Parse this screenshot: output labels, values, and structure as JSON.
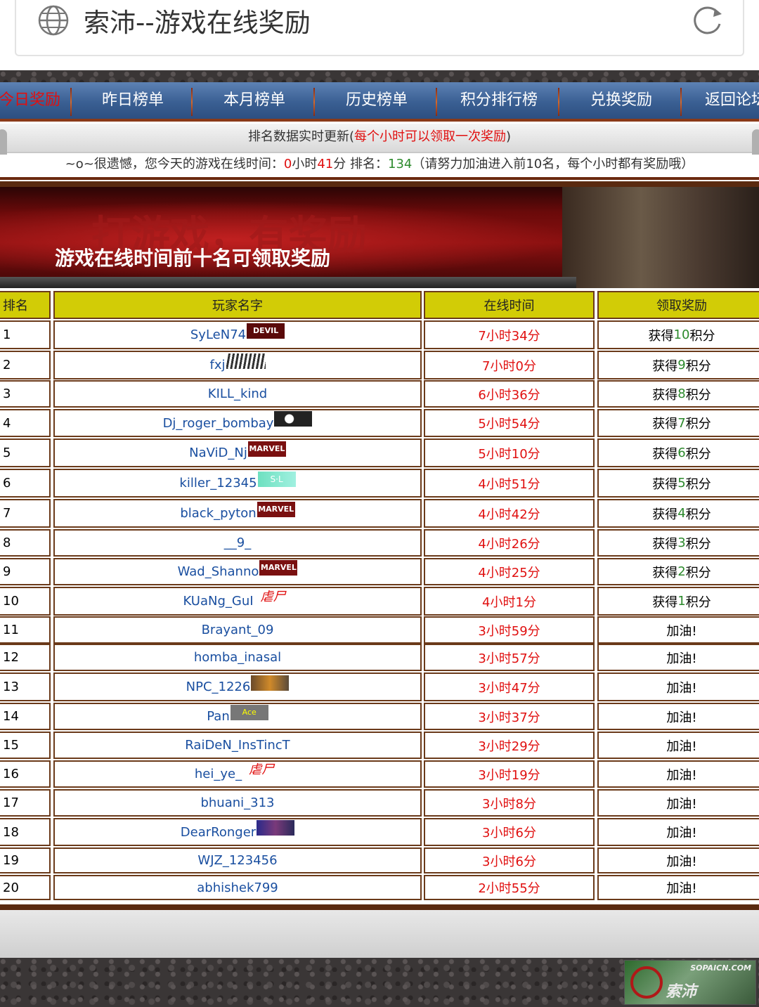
{
  "browser": {
    "title": "索沛--游戏在线奖励"
  },
  "nav": {
    "items": [
      {
        "label": "今日奖励",
        "active": true
      },
      {
        "label": "昨日榜单",
        "active": false
      },
      {
        "label": "本月榜单",
        "active": false
      },
      {
        "label": "历史榜单",
        "active": false
      },
      {
        "label": "积分排行榜",
        "active": false
      },
      {
        "label": "兑换奖励",
        "active": false
      },
      {
        "label": "返回论坛",
        "active": false
      }
    ]
  },
  "notice": {
    "line1_prefix": "排名数据实时更新(",
    "line1_highlight": "每个小时可以领取一次奖励",
    "line1_suffix": ")",
    "line2_a": "~o~很遗憾，您今天的游戏在线时间：",
    "hours": "0",
    "line2_b": "小时",
    "minutes": "41",
    "line2_c": "分 排名：",
    "rank": "134",
    "line2_d": "（请努力加油进入前10名，每个小时都有奖励哦）"
  },
  "banner": {
    "bg_text": "打游戏，有奖励",
    "caption": "游戏在线时间前十名可领取奖励"
  },
  "table": {
    "headers": [
      "排名",
      "玩家名字",
      "在线时间",
      "领取奖励"
    ],
    "rows": [
      {
        "rank": "1",
        "name": "SyLeN74",
        "badge": "devil",
        "time": "7小时34分",
        "reward_a": "获得",
        "points": "10",
        "reward_b": "积分"
      },
      {
        "rank": "2",
        "name": "fxj",
        "badge": "rays",
        "time": "7小时0分",
        "reward_a": "获得",
        "points": "9",
        "reward_b": "积分"
      },
      {
        "rank": "3",
        "name": "KILL_kind",
        "badge": "",
        "time": "6小时36分",
        "reward_a": "获得",
        "points": "8",
        "reward_b": "积分"
      },
      {
        "rank": "4",
        "name": "Dj_roger_bombay",
        "badge": "blot",
        "time": "5小时54分",
        "reward_a": "获得",
        "points": "7",
        "reward_b": "积分"
      },
      {
        "rank": "5",
        "name": "NaViD_Nj",
        "badge": "marvel",
        "time": "5小时10分",
        "reward_a": "获得",
        "points": "6",
        "reward_b": "积分"
      },
      {
        "rank": "6",
        "name": "killer_12345",
        "badge": "sl",
        "time": "4小时51分",
        "reward_a": "获得",
        "points": "5",
        "reward_b": "积分"
      },
      {
        "rank": "7",
        "name": "black_pyton",
        "badge": "marvel",
        "time": "4小时42分",
        "reward_a": "获得",
        "points": "4",
        "reward_b": "积分"
      },
      {
        "rank": "8",
        "name": "__9_",
        "badge": "",
        "time": "4小时26分",
        "reward_a": "获得",
        "points": "3",
        "reward_b": "积分"
      },
      {
        "rank": "9",
        "name": "Wad_Shanno",
        "badge": "marvel",
        "time": "4小时25分",
        "reward_a": "获得",
        "points": "2",
        "reward_b": "积分"
      },
      {
        "rank": "10",
        "name": "KUaNg_GuI",
        "badge": "zombie",
        "time": "4小时1分",
        "reward_a": "获得",
        "points": "1",
        "reward_b": "积分"
      },
      {
        "rank": "11",
        "name": "Brayant_09",
        "badge": "",
        "time": "3小时59分",
        "reward_a": "加油!",
        "points": "",
        "reward_b": ""
      },
      {
        "rank": "12",
        "name": "homba_inasal",
        "badge": "",
        "time": "3小时57分",
        "reward_a": "加油!",
        "points": "",
        "reward_b": ""
      },
      {
        "rank": "13",
        "name": "NPC_1226",
        "badge": "fire",
        "time": "3小时47分",
        "reward_a": "加油!",
        "points": "",
        "reward_b": ""
      },
      {
        "rank": "14",
        "name": "Pan",
        "badge": "ace",
        "time": "3小时37分",
        "reward_a": "加油!",
        "points": "",
        "reward_b": ""
      },
      {
        "rank": "15",
        "name": "RaiDeN_InsTincT",
        "badge": "",
        "time": "3小时29分",
        "reward_a": "加油!",
        "points": "",
        "reward_b": ""
      },
      {
        "rank": "16",
        "name": "hei_ye_",
        "badge": "zombie",
        "time": "3小时19分",
        "reward_a": "加油!",
        "points": "",
        "reward_b": ""
      },
      {
        "rank": "17",
        "name": "bhuani_313",
        "badge": "",
        "time": "3小时8分",
        "reward_a": "加油!",
        "points": "",
        "reward_b": ""
      },
      {
        "rank": "18",
        "name": "DearRonger",
        "badge": "galaxy",
        "time": "3小时6分",
        "reward_a": "加油!",
        "points": "",
        "reward_b": ""
      },
      {
        "rank": "19",
        "name": "WJZ_123456",
        "badge": "",
        "time": "3小时6分",
        "reward_a": "加油!",
        "points": "",
        "reward_b": ""
      },
      {
        "rank": "20",
        "name": "abhishek799",
        "badge": "",
        "time": "2小时55分",
        "reward_a": "加油!",
        "points": "",
        "reward_b": ""
      }
    ]
  },
  "badges": {
    "devil": "DEVIL",
    "marvel": "MARVEL",
    "sl": "S·L",
    "zombie": "虐尸",
    "ace": "Ace"
  },
  "footer": {
    "logo_site": "SOPAICN.COM",
    "logo_word": "索沛"
  },
  "colors": {
    "accent_red": "#e01010",
    "nav_blue": "#3a5f93",
    "header_yellow": "#d2cc06",
    "link_blue": "#1a4fa0",
    "points_green": "#2c8a2c",
    "border_brown": "#6b3a1a"
  }
}
